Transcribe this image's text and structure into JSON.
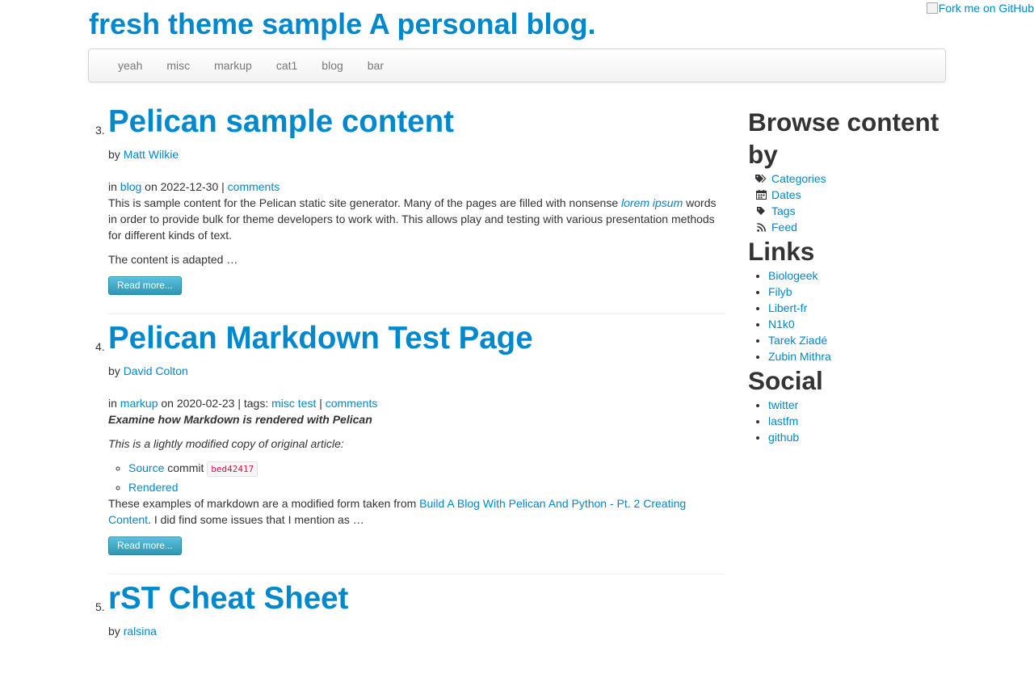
{
  "fork_label": "Fork me on GitHub",
  "site_title": "fresh theme sample A personal blog.",
  "nav": [
    {
      "label": "yeah"
    },
    {
      "label": "misc"
    },
    {
      "label": "markup"
    },
    {
      "label": "cat1"
    },
    {
      "label": "blog"
    },
    {
      "label": "bar"
    }
  ],
  "articles": [
    {
      "number": "3.",
      "title": "Pelican sample content",
      "by_label": "by",
      "author": "Matt Wilkie",
      "in_label": "in",
      "category": "blog",
      "date_text": "on 2022-12-30 |",
      "comments": "comments",
      "summary_before": "This is sample content for the Pelican static site generator. Many of the pages are filled with nonsense",
      "summary_link": "lorem ipsum",
      "summary_after": "words in order to provide bulk for theme developers to work with. This allows play and testing with various presentation methods for different kinds of text.",
      "summary_tail": "The content is adapted …",
      "read_more": "Read more..."
    },
    {
      "number": "4.",
      "title": "Pelican Markdown Test Page",
      "by_label": "by",
      "author": "David Colton",
      "in_label": "in",
      "category": "markup",
      "date_text": "on 2020-02-23 | tags:",
      "tags": "misc test",
      "sep": "|",
      "comments": "comments",
      "lead": "Examine how Markdown is rendered with Pelican",
      "note": "This is a lightly modified copy of original article:",
      "source_link": "Source",
      "commit_label": "commit",
      "commit_hash": "bed42417",
      "rendered_link": "Rendered",
      "para_before": "These examples of markdown are a modified form taken from",
      "para_link": "Build A Blog With Pelican And Python - Pt. 2 Creating Content",
      "para_after": ". I did find some issues that I mention as …",
      "read_more": "Read more..."
    },
    {
      "number": "5.",
      "title": "rST Cheat Sheet",
      "by_label": "by",
      "author": "ralsina"
    }
  ],
  "sidebar": {
    "browse_title": "Browse content by",
    "browse_items": [
      {
        "label": "Categories",
        "icon": "tags-icon"
      },
      {
        "label": "Dates",
        "icon": "calendar-icon"
      },
      {
        "label": "Tags",
        "icon": "tag-icon"
      },
      {
        "label": "Feed",
        "icon": "rss-icon"
      }
    ],
    "links_title": "Links",
    "links": [
      "Biologeek",
      "Filyb",
      "Libert-fr",
      "N1k0",
      "Tarek Ziadé",
      "Zubin Mithra"
    ],
    "social_title": "Social",
    "social": [
      "twitter",
      "lastfm",
      "github"
    ]
  },
  "colors": {
    "link": "#0088cc",
    "text": "#333333",
    "button": "#2f96b4"
  }
}
